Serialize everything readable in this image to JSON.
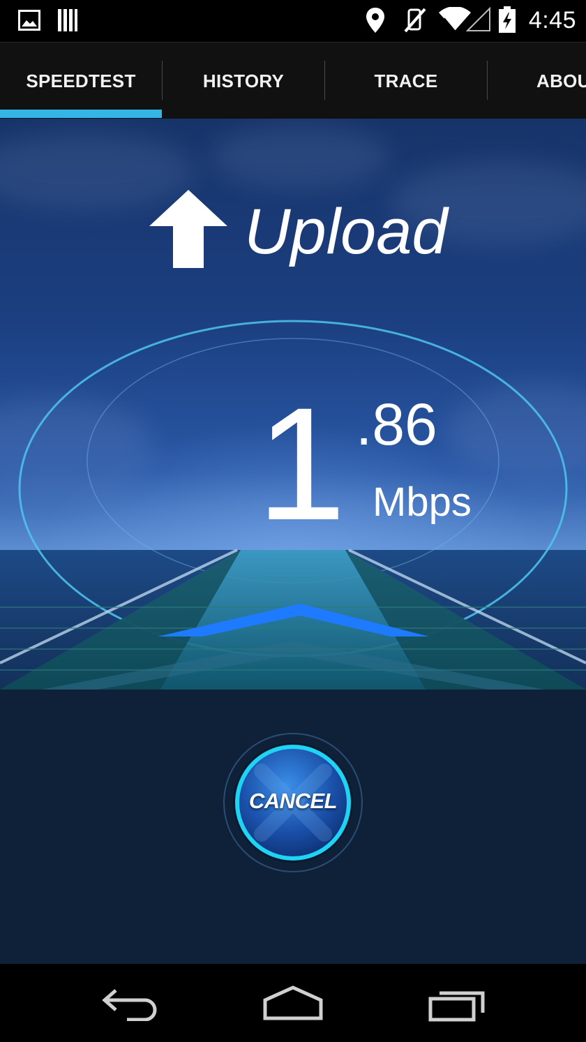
{
  "status_bar": {
    "time": "4:45",
    "icons": [
      "gallery-icon",
      "barcode-icon",
      "location-icon",
      "muted-icon",
      "wifi-icon",
      "signal-icon",
      "battery-charging-icon"
    ]
  },
  "tabs": [
    {
      "label": "SPEEDTEST",
      "selected": true
    },
    {
      "label": "HISTORY",
      "selected": false
    },
    {
      "label": "TRACE",
      "selected": false
    },
    {
      "label": "ABOU",
      "selected": false
    }
  ],
  "test": {
    "direction_label": "Upload",
    "speed_integer": "1",
    "speed_decimal": ".86",
    "unit": "Mbps"
  },
  "cancel_button": {
    "label": "CANCEL"
  },
  "nav": [
    "back-icon",
    "home-icon",
    "recents-icon"
  ],
  "colors": {
    "accent": "#33b5e5",
    "tab_bar": "#111111",
    "panel": "#0f2139",
    "gauge_ring": "#4fc6ee",
    "road_chevron": "#1e7bff"
  }
}
